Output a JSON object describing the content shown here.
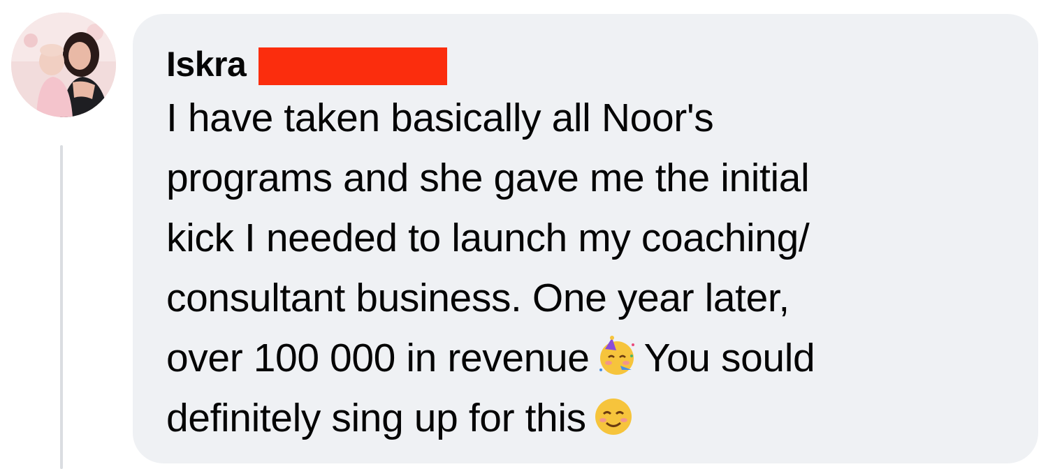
{
  "comment": {
    "author_first_name": "Iskra",
    "author_last_name_redacted": true,
    "text_lines": [
      "I have taken basically all Noor's",
      "programs and she gave me the initial",
      "kick I needed to launch my coaching/",
      "consultant business. One year later,",
      "over 100 000 in revenue",
      "You sould",
      "definitely sing up for this"
    ],
    "emojis": [
      "partying-face-emoji",
      "smiling-face-emoji"
    ]
  },
  "colors": {
    "bubble_bg": "#eff1f4",
    "text": "#050505",
    "redaction": "#fb2d0d",
    "thread_line": "#dadde1"
  }
}
